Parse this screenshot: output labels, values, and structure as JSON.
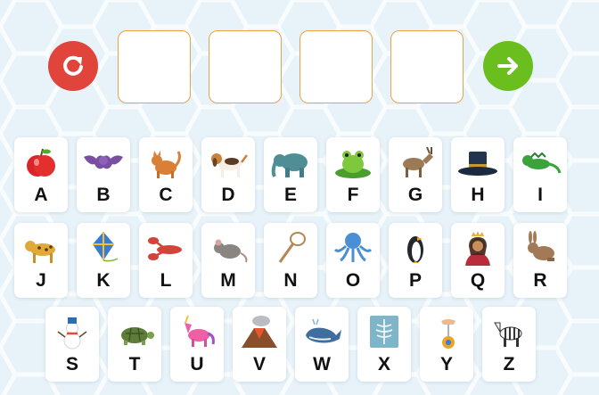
{
  "controls": {
    "reset_icon": "refresh-icon",
    "next_icon": "arrow-right-icon",
    "reset_color": "#e0443b",
    "next_color": "#6abf1e"
  },
  "answer_slots": [
    "",
    "",
    "",
    ""
  ],
  "cards": [
    {
      "letter": "A",
      "icon": "apple-icon"
    },
    {
      "letter": "B",
      "icon": "bat-icon"
    },
    {
      "letter": "C",
      "icon": "cat-icon"
    },
    {
      "letter": "D",
      "icon": "dog-icon"
    },
    {
      "letter": "E",
      "icon": "elephant-icon"
    },
    {
      "letter": "F",
      "icon": "frog-icon"
    },
    {
      "letter": "G",
      "icon": "goat-icon"
    },
    {
      "letter": "H",
      "icon": "hat-icon"
    },
    {
      "letter": "I",
      "icon": "iguana-icon"
    },
    {
      "letter": "J",
      "icon": "jaguar-icon"
    },
    {
      "letter": "K",
      "icon": "kite-icon"
    },
    {
      "letter": "L",
      "icon": "lobster-icon"
    },
    {
      "letter": "M",
      "icon": "mouse-icon"
    },
    {
      "letter": "N",
      "icon": "net-icon"
    },
    {
      "letter": "O",
      "icon": "octopus-icon"
    },
    {
      "letter": "P",
      "icon": "penguin-icon"
    },
    {
      "letter": "Q",
      "icon": "queen-icon"
    },
    {
      "letter": "R",
      "icon": "rabbit-icon"
    },
    {
      "letter": "S",
      "icon": "snowman-icon"
    },
    {
      "letter": "T",
      "icon": "turtle-icon"
    },
    {
      "letter": "U",
      "icon": "unicorn-icon"
    },
    {
      "letter": "V",
      "icon": "volcano-icon"
    },
    {
      "letter": "W",
      "icon": "whale-icon"
    },
    {
      "letter": "X",
      "icon": "x-ray-icon"
    },
    {
      "letter": "Y",
      "icon": "yo-yo-icon"
    },
    {
      "letter": "Z",
      "icon": "zebra-icon"
    }
  ]
}
